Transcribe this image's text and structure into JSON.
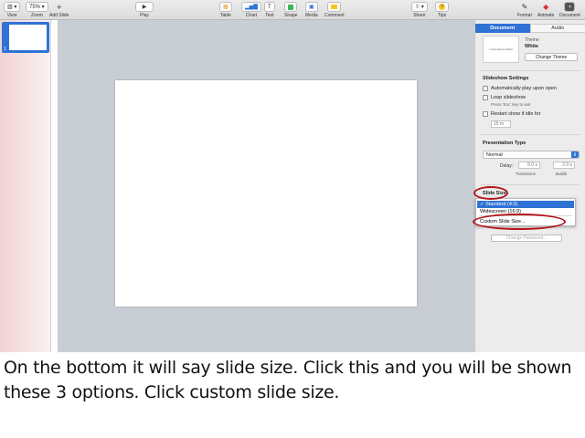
{
  "toolbar": {
    "view": "View",
    "zoom_value": "75%",
    "zoom": "Zoom",
    "add_slide": "Add Slide",
    "play": "Play",
    "table": "Table",
    "chart": "Chart",
    "text": "Text",
    "shape": "Shape",
    "media": "Media",
    "comment": "Comment",
    "share": "Share",
    "tips": "Tips",
    "format": "Format",
    "animate": "Animate",
    "document": "Document"
  },
  "navigator": {
    "slide_number": "1"
  },
  "inspector": {
    "tabs": {
      "document": "Document",
      "audio": "Audio"
    },
    "theme_thumb_text": "Lorem Ipsum Dolor",
    "theme_label": "Theme",
    "theme_name": "White",
    "change_theme": "Change Theme",
    "slideshow_settings": "Slideshow Settings",
    "auto_play": "Automatically play upon open",
    "loop": "Loop slideshow",
    "loop_hint": "Press 'Esc' key to exit",
    "restart": "Restart show if idle for",
    "idle_value": "15 m",
    "presentation_type": "Presentation Type",
    "type_value": "Normal",
    "delay": "Delay:",
    "delay_transitions": "5.0 s",
    "delay_builds": "2.0 s",
    "transitions": "Transitions",
    "builds": "Builds",
    "slide_size": "Slide Size",
    "change_password": "Change Password..."
  },
  "slide_size_menu": {
    "standard": "✓ Standard (4:3)",
    "widescreen": "Widescreen (16:9)",
    "custom": "Custom Slide Size..."
  },
  "caption": "On the bottom it will say slide size. Click this and you will be shown these 3 options. Click custom slide size.",
  "colors": {
    "accent": "#2f72d6",
    "annotation": "#b3141a",
    "canvas": "#c9ced5"
  }
}
